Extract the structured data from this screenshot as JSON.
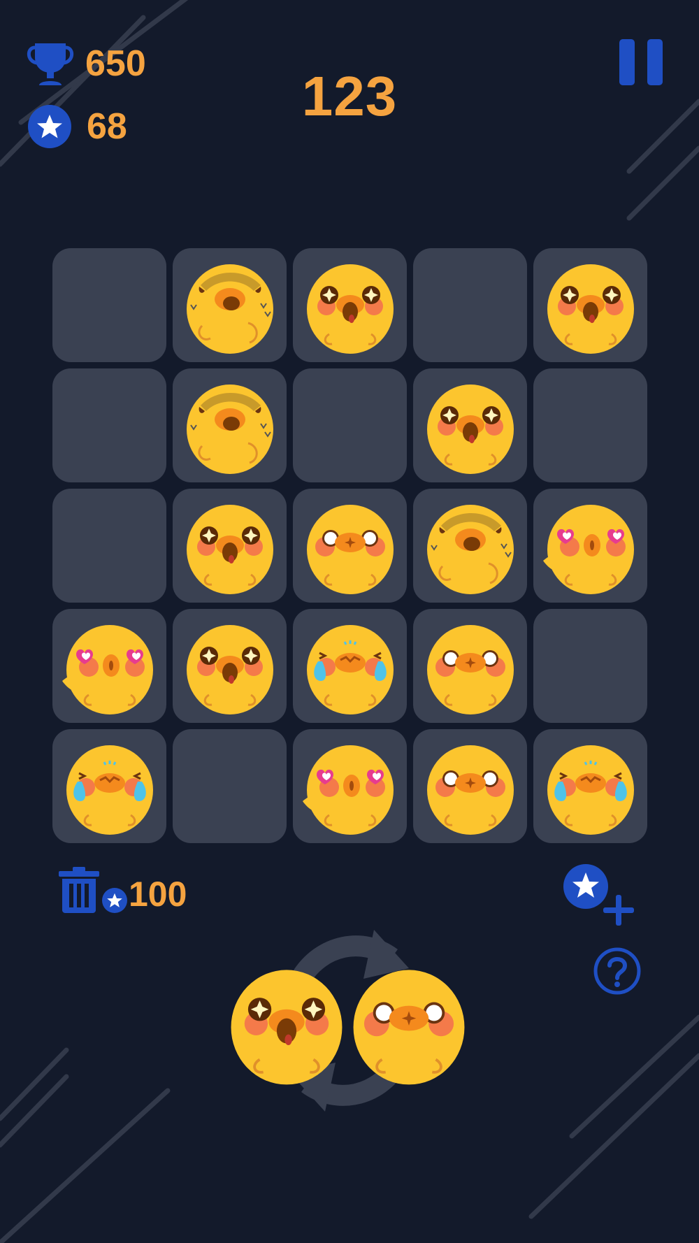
{
  "hud": {
    "best_score": "650",
    "best_icon": "trophy-icon",
    "stars": "68",
    "star_icon": "star-icon",
    "current_score": "123",
    "pause_icon": "pause-icon"
  },
  "board": {
    "rows": [
      [
        "empty",
        "sweat",
        "starry",
        "empty",
        "starry"
      ],
      [
        "empty",
        "sweat",
        "empty",
        "starry",
        "empty"
      ],
      [
        "empty",
        "starry",
        "surprised",
        "sweat",
        "love"
      ],
      [
        "love",
        "starry",
        "crying",
        "surprised",
        "empty"
      ],
      [
        "crying",
        "empty",
        "love",
        "surprised",
        "crying"
      ]
    ]
  },
  "tools": {
    "trash_icon": "trash-icon",
    "trash_cost": "100",
    "add_stars_icon": "add-stars-icon",
    "help_icon": "help-icon",
    "rotate_icon": "rotate-icon"
  },
  "next_piece": [
    "starry",
    "surprised"
  ],
  "colors": {
    "background": "#131a2b",
    "cell": "#3a4152",
    "accent_orange": "#f5a340",
    "accent_blue": "#1f4fc4",
    "chick_yellow": "#fcc52e"
  }
}
